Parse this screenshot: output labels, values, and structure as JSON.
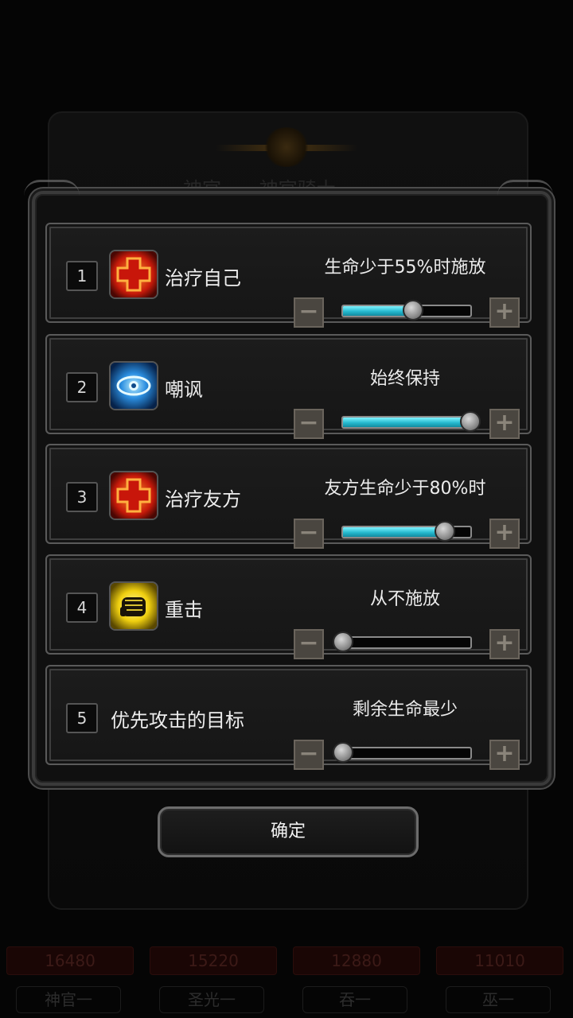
{
  "background": {
    "tabs": [
      "神官",
      "神官骑士"
    ]
  },
  "rows": [
    {
      "num": "1",
      "icon": "heal-cross-icon",
      "name": "治疗自己",
      "condition": "生命少于55%时施放",
      "level": 0.55
    },
    {
      "num": "2",
      "icon": "taunt-eye-icon",
      "name": "嘲讽",
      "condition": "始终保持",
      "level": 1.0
    },
    {
      "num": "3",
      "icon": "heal-cross-icon",
      "name": "治疗友方",
      "condition": "友方生命少于80%时",
      "level": 0.8
    },
    {
      "num": "4",
      "icon": "fist-strike-icon",
      "name": "重击",
      "condition": "从不施放",
      "level": 0.0
    },
    {
      "num": "5",
      "icon": "",
      "name": "优先攻击的目标",
      "condition": "剩余生命最少",
      "level": 0.0
    }
  ],
  "stepper": {
    "minus": "−",
    "plus": "+"
  },
  "confirm_label": "确定",
  "team": [
    {
      "power": "16480",
      "name": "神官一"
    },
    {
      "power": "15220",
      "name": "圣光一"
    },
    {
      "power": "12880",
      "name": "吞一"
    },
    {
      "power": "11010",
      "name": "巫一"
    }
  ]
}
